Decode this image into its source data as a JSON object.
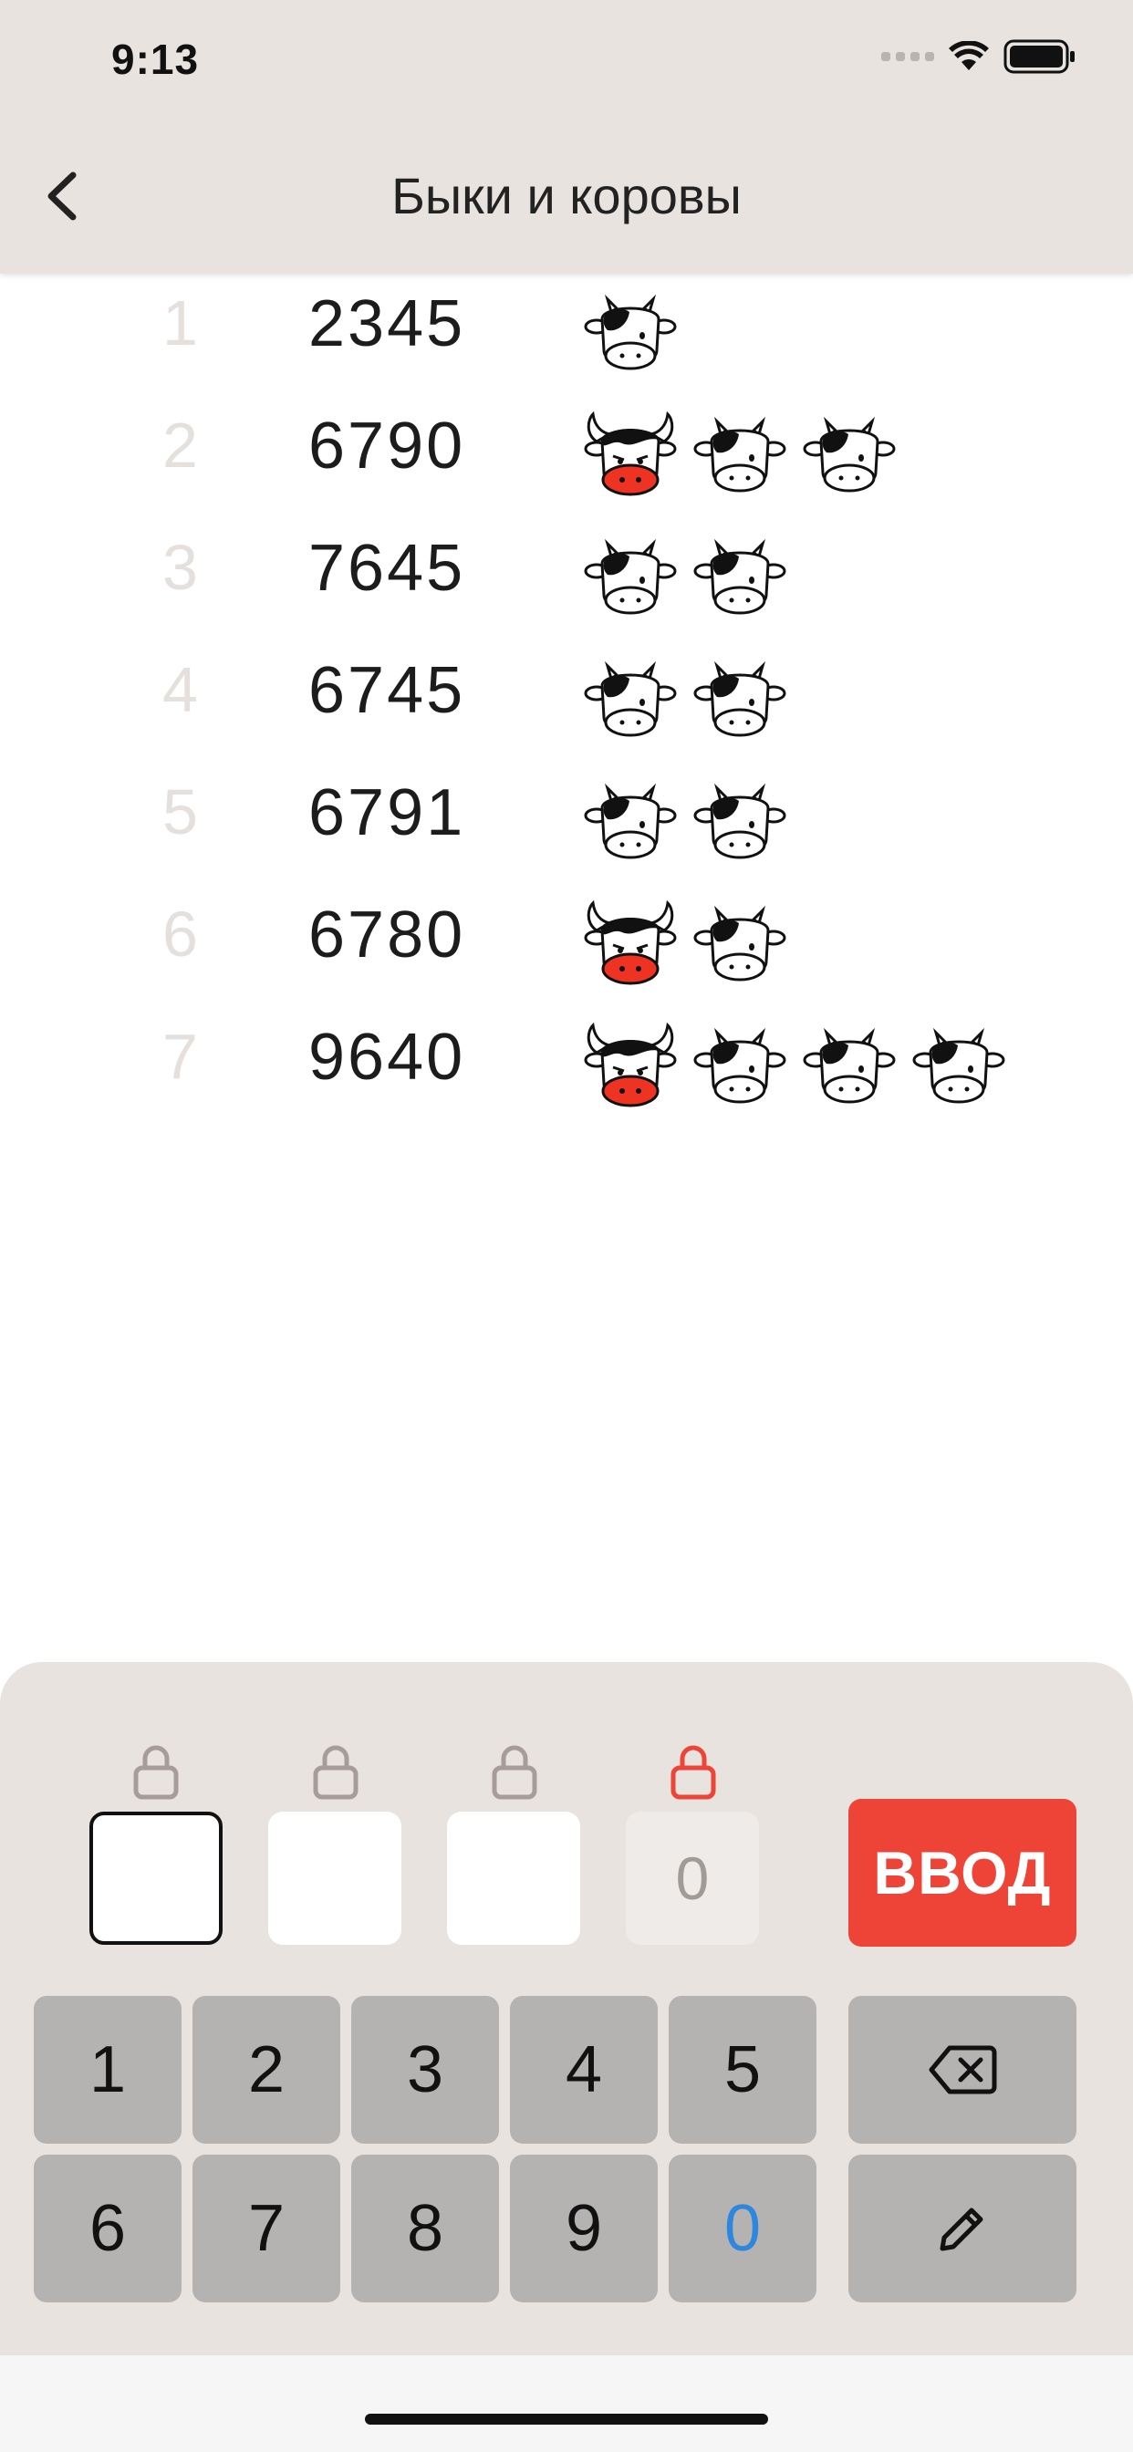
{
  "status_bar": {
    "time": "9:13"
  },
  "header": {
    "title": "Быки и коровы"
  },
  "guesses": [
    {
      "index": "1",
      "value": "2345",
      "bulls": 0,
      "cows": 1
    },
    {
      "index": "2",
      "value": "6790",
      "bulls": 1,
      "cows": 2
    },
    {
      "index": "3",
      "value": "7645",
      "bulls": 0,
      "cows": 2
    },
    {
      "index": "4",
      "value": "6745",
      "bulls": 0,
      "cows": 2
    },
    {
      "index": "5",
      "value": "6791",
      "bulls": 0,
      "cows": 2
    },
    {
      "index": "6",
      "value": "6780",
      "bulls": 1,
      "cows": 1
    },
    {
      "index": "7",
      "value": "9640",
      "bulls": 1,
      "cows": 3
    }
  ],
  "input": {
    "slots": [
      {
        "value": "",
        "state": "active"
      },
      {
        "value": "",
        "state": "empty"
      },
      {
        "value": "",
        "state": "empty"
      },
      {
        "value": "0",
        "state": "locked"
      }
    ],
    "locks": [
      "unlocked",
      "unlocked",
      "unlocked",
      "locked"
    ],
    "enter_label": "ВВОД"
  },
  "keypad": {
    "keys": [
      "1",
      "2",
      "3",
      "4",
      "5",
      "6",
      "7",
      "8",
      "9",
      "0"
    ],
    "disabled_digit": "0"
  },
  "colors": {
    "header_bg": "#e8e3df",
    "accent_red": "#ee4337",
    "lock_gray": "#a69d98",
    "lock_red": "#ee4337",
    "key_bg": "#b5b3b1",
    "highlight_blue": "#2e86de"
  },
  "icons": {
    "back": "chevron-left-icon",
    "backspace": "backspace-icon",
    "edit": "pencil-icon",
    "lock": "lock-icon",
    "cow": "cow-face-icon",
    "bull": "bull-face-icon"
  }
}
